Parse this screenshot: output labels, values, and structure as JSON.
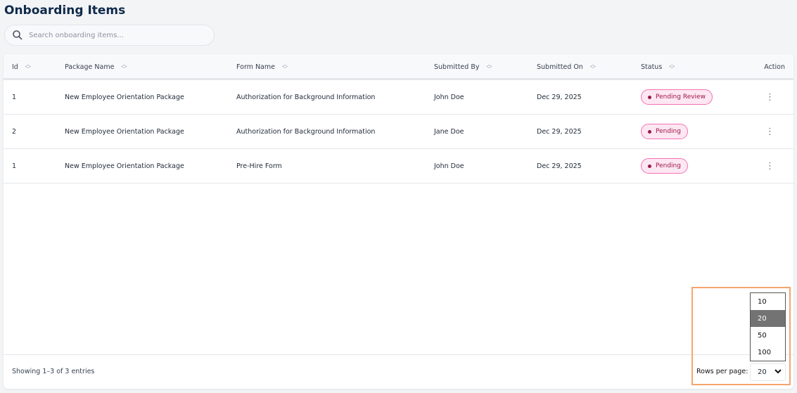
{
  "page": {
    "title": "Onboarding Items"
  },
  "search": {
    "placeholder": "Search onboarding items..."
  },
  "table": {
    "columns": [
      "Id",
      "Package Name",
      "Form Name",
      "Submitted By",
      "Submitted On",
      "Status",
      "Action"
    ],
    "rows": [
      {
        "id": "1",
        "package": "New Employee Orientation Package",
        "form": "Authorization for Background Information",
        "by": "John Doe",
        "on": "Dec 29, 2025",
        "status": "Pending Review"
      },
      {
        "id": "2",
        "package": "New Employee Orientation Package",
        "form": "Authorization for Background Information",
        "by": "Jane Doe",
        "on": "Dec 29, 2025",
        "status": "Pending"
      },
      {
        "id": "1",
        "package": "New Employee Orientation Package",
        "form": "Pre-Hire Form",
        "by": "John Doe",
        "on": "Dec 29, 2025",
        "status": "Pending"
      }
    ]
  },
  "footer": {
    "showing": "Showing 1–3 of 3 entries",
    "rows_per_page_label": "Rows per page:",
    "rows_per_page": "20",
    "options": [
      "10",
      "20",
      "50",
      "100"
    ]
  },
  "colors": {
    "title": "#0f2a4a",
    "badge_bg": "#fde7f2",
    "badge_text": "#9d174d",
    "highlight": "#f6a56f"
  }
}
